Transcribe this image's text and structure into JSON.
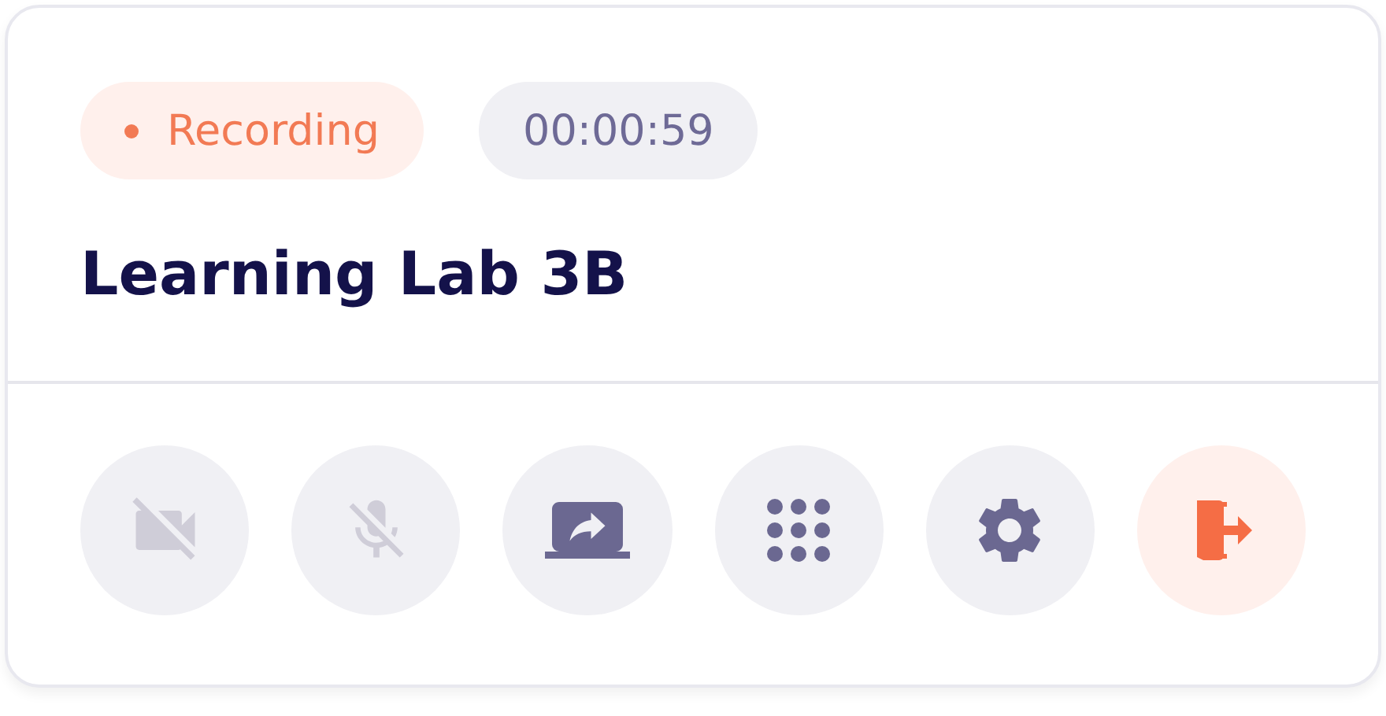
{
  "status": {
    "label": "Recording",
    "recording": true
  },
  "timer": "00:00:59",
  "title": "Learning Lab 3B",
  "controls": [
    {
      "kind": "camera",
      "on": false
    },
    {
      "kind": "mic",
      "on": false
    },
    {
      "kind": "share"
    },
    {
      "kind": "apps"
    },
    {
      "kind": "settings"
    },
    {
      "kind": "leave"
    }
  ]
}
